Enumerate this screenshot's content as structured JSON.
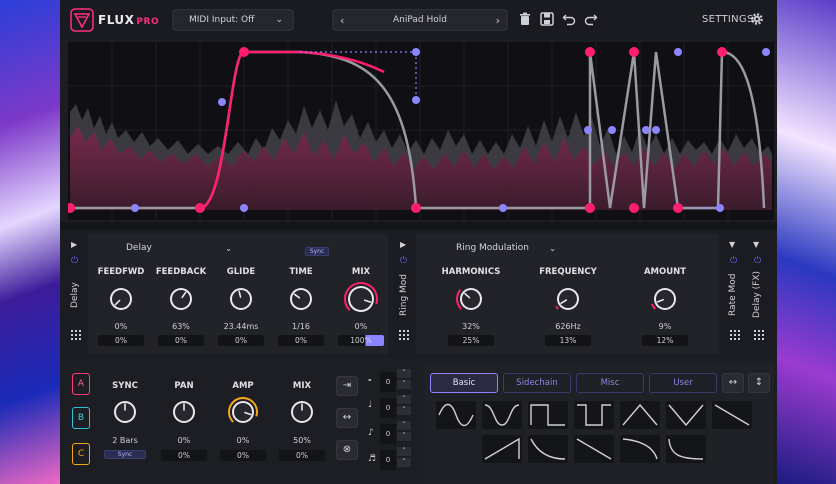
{
  "header": {
    "brand_name": "FLUX",
    "brand_suffix": "PRO",
    "midi_input": "MIDI Input: Off",
    "preset_name": "AniPad Hold",
    "settings_label": "SETTINGS"
  },
  "colors": {
    "accent": "#ff1f6e",
    "accent_secondary": "#8b86ff",
    "panel_bg": "#222329"
  },
  "module_delay": {
    "side_label": "Delay",
    "dropdown": "Delay",
    "sync_label": "Sync",
    "knobs": [
      {
        "label": "FEEDFWD",
        "value": "0%",
        "box": "0%",
        "level": 0.0
      },
      {
        "label": "FEEDBACK",
        "value": "63%",
        "box": "0%",
        "level": 0.63
      },
      {
        "label": "GLIDE",
        "value": "23.44ms",
        "box": "0%",
        "level": 0.45
      },
      {
        "label": "TIME",
        "value": "1/16",
        "box": "0%",
        "level": 0.3
      },
      {
        "label": "MIX",
        "value": "0%",
        "box": "100%",
        "level": 0.9
      }
    ]
  },
  "module_ring": {
    "side_label": "Ring Mod",
    "dropdown": "Ring Modulation",
    "knobs": [
      {
        "label": "HARMONICS",
        "value": "32%",
        "box": "25%",
        "level": 0.32
      },
      {
        "label": "FREQUENCY",
        "value": "626Hz",
        "box": "13%",
        "level": 0.05
      },
      {
        "label": "AMOUNT",
        "value": "9%",
        "box": "12%",
        "level": 0.09
      }
    ]
  },
  "right_strips": {
    "rate_mod": "Rate Mod",
    "delay_fx": "Delay (FX)"
  },
  "lfo": {
    "slots": [
      "A",
      "B",
      "C"
    ],
    "knobs": [
      {
        "label": "SYNC",
        "value": "2 Bars",
        "box": "Sync",
        "level": 0.5
      },
      {
        "label": "PAN",
        "value": "0%",
        "box": "0%",
        "level": 0.5
      },
      {
        "label": "AMP",
        "value": "0%",
        "box": "0%",
        "level": 0.9
      },
      {
        "label": "MIX",
        "value": "50%",
        "box": "0%",
        "level": 0.5
      }
    ],
    "steppers": [
      "0",
      "0",
      "0",
      "0"
    ]
  },
  "shapes": {
    "tabs": [
      "Basic",
      "Sidechain",
      "Misc",
      "User"
    ],
    "active_tab": "Basic"
  }
}
